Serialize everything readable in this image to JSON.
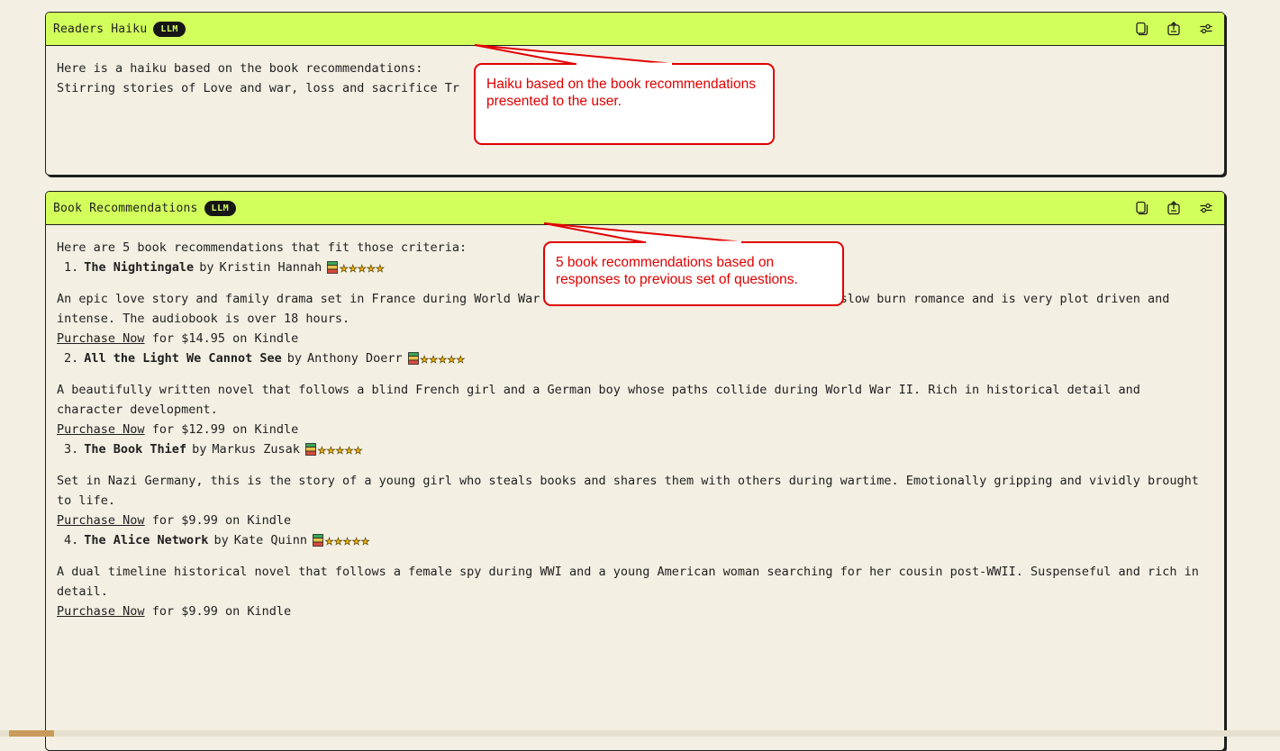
{
  "haiku_panel": {
    "title": "Readers Haiku",
    "badge": "LLM",
    "intro": "Here is a haiku based on the book recommendations:",
    "haiku_text": "Stirring stories of Love and war, loss and sacrifice Tr",
    "icons": [
      "copy-icon",
      "share-icon",
      "settings-sliders-icon"
    ]
  },
  "recommendations_panel": {
    "title": "Book Recommendations",
    "badge": "LLM",
    "intro": "Here are 5 book recommendations that fit those criteria:",
    "books": [
      {
        "num": "1.",
        "title": "The Nightingale",
        "by": "by",
        "author": "Kristin Hannah",
        "stars": "★★★★★",
        "description": "An epic love story and family drama set in France during World War II. This historical fiction novel has a slow burn romance and is very plot driven and intense. The audiobook is over 18 hours.",
        "purchase_link": "Purchase Now",
        "purchase_rest": "for $14.95 on Kindle"
      },
      {
        "num": "2.",
        "title": "All the Light We Cannot See",
        "by": "by",
        "author": "Anthony Doerr",
        "stars": "★★★★★",
        "description": "A beautifully written novel that follows a blind French girl and a German boy whose paths collide during World War II. Rich in historical detail and character development.",
        "purchase_link": "Purchase Now",
        "purchase_rest": "for $12.99 on Kindle"
      },
      {
        "num": "3.",
        "title": "The Book Thief",
        "by": "by",
        "author": "Markus Zusak",
        "stars": "★★★★★",
        "description": "Set in Nazi Germany, this is the story of a young girl who steals books and shares them with others during wartime. Emotionally gripping and vividly brought to life.",
        "purchase_link": "Purchase Now",
        "purchase_rest": "for $9.99 on Kindle"
      },
      {
        "num": "4.",
        "title": "The Alice Network",
        "by": "by",
        "author": "Kate Quinn",
        "stars": "★★★★★",
        "description": "A dual timeline historical novel that follows a female spy during WWI and a young American woman searching for her cousin post-WWII. Suspenseful and rich in detail.",
        "purchase_link": "Purchase Now",
        "purchase_rest": "for $9.99 on Kindle"
      }
    ]
  },
  "callouts": {
    "haiku": "Haiku based on the book recommendations presented to the user.",
    "recommendations": "5 book recommendations based on responses to previous set of questions."
  },
  "colors": {
    "header_bg": "#d2ff5c",
    "page_bg": "#f3efe3",
    "callout_red": "#e00000",
    "star_gold": "#f6b900"
  }
}
